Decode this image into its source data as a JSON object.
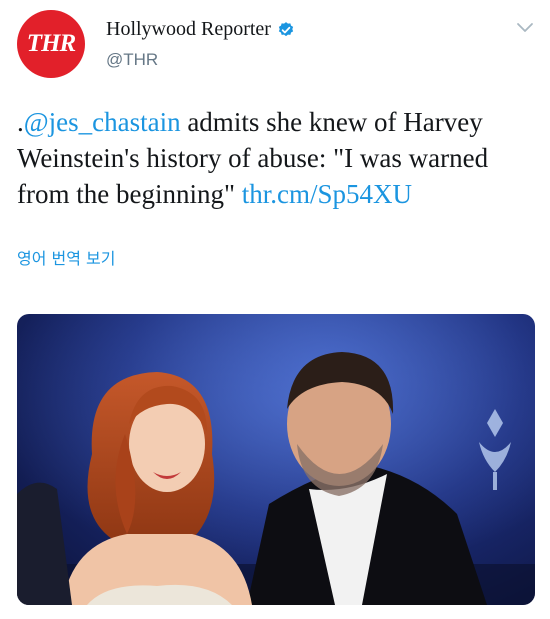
{
  "author": {
    "avatar_text": "THR",
    "display_name": "Hollywood Reporter",
    "handle": "@THR"
  },
  "tweet": {
    "prefix": ".",
    "mention": "@jes_chastain",
    "body": " admits she knew of Harvey Weinstein's history of abuse: \"I was warned from the beginning\" ",
    "link": "thr.cm/Sp54XU"
  },
  "translate_label": "영어 번역 보기",
  "icons": {
    "verified": "verified-badge-icon",
    "menu": "chevron-down-icon"
  },
  "colors": {
    "brand_red": "#e2202a",
    "link_blue": "#1b95e0",
    "text": "#14171a",
    "secondary": "#657786"
  }
}
